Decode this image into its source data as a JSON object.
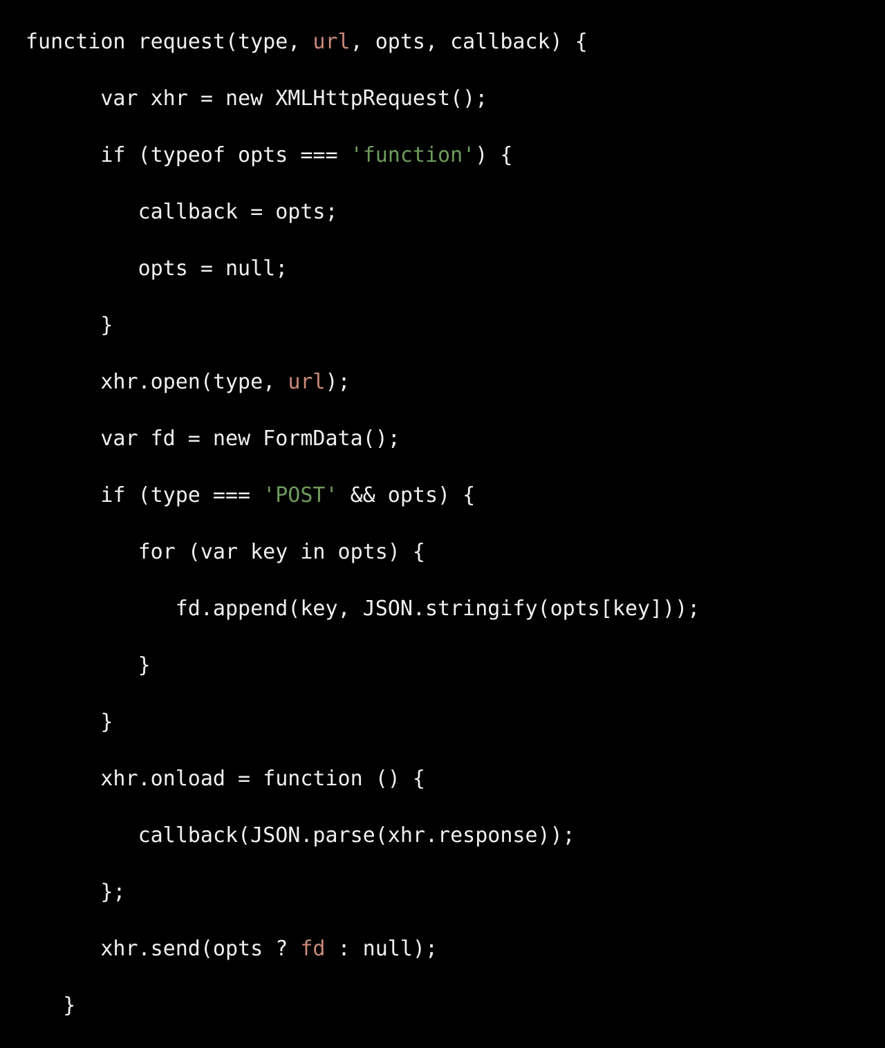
{
  "editor": {
    "background_color": "#000000",
    "default_text_color": "#f2f0ee",
    "variable_token_color": "#c98b7b",
    "string_token_color": "#6f9a5c",
    "language": "javascript"
  },
  "code": {
    "lines": [
      {
        "indent": "",
        "tokens": [
          {
            "t": "function request(type, ",
            "k": "plain"
          },
          {
            "t": "url",
            "k": "var"
          },
          {
            "t": ", opts, callback) {",
            "k": "plain"
          }
        ]
      },
      {
        "indent": "      ",
        "tokens": [
          {
            "t": "var xhr = new XMLHttpRequest();",
            "k": "plain"
          }
        ]
      },
      {
        "indent": "      ",
        "tokens": [
          {
            "t": "if (typeof opts === ",
            "k": "plain"
          },
          {
            "t": "'function'",
            "k": "str"
          },
          {
            "t": ") {",
            "k": "plain"
          }
        ]
      },
      {
        "indent": "         ",
        "tokens": [
          {
            "t": "callback = opts;",
            "k": "plain"
          }
        ]
      },
      {
        "indent": "         ",
        "tokens": [
          {
            "t": "opts = null;",
            "k": "plain"
          }
        ]
      },
      {
        "indent": "      ",
        "tokens": [
          {
            "t": "}",
            "k": "plain"
          }
        ]
      },
      {
        "indent": "      ",
        "tokens": [
          {
            "t": "xhr.open(type, ",
            "k": "plain"
          },
          {
            "t": "url",
            "k": "var"
          },
          {
            "t": ");",
            "k": "plain"
          }
        ]
      },
      {
        "indent": "      ",
        "tokens": [
          {
            "t": "var fd = new FormData();",
            "k": "plain"
          }
        ]
      },
      {
        "indent": "      ",
        "tokens": [
          {
            "t": "if (type === ",
            "k": "plain"
          },
          {
            "t": "'POST'",
            "k": "str"
          },
          {
            "t": " && opts) {",
            "k": "plain"
          }
        ]
      },
      {
        "indent": "         ",
        "tokens": [
          {
            "t": "for (var key in opts) {",
            "k": "plain"
          }
        ]
      },
      {
        "indent": "            ",
        "tokens": [
          {
            "t": "fd.append(key, JSON.stringify(opts[key]));",
            "k": "plain"
          }
        ]
      },
      {
        "indent": "         ",
        "tokens": [
          {
            "t": "}",
            "k": "plain"
          }
        ]
      },
      {
        "indent": "      ",
        "tokens": [
          {
            "t": "}",
            "k": "plain"
          }
        ]
      },
      {
        "indent": "      ",
        "tokens": [
          {
            "t": "xhr.onload = function () {",
            "k": "plain"
          }
        ]
      },
      {
        "indent": "         ",
        "tokens": [
          {
            "t": "callback(JSON.parse(xhr.response));",
            "k": "plain"
          }
        ]
      },
      {
        "indent": "      ",
        "tokens": [
          {
            "t": "};",
            "k": "plain"
          }
        ]
      },
      {
        "indent": "      ",
        "tokens": [
          {
            "t": "xhr.send(opts ? ",
            "k": "plain"
          },
          {
            "t": "fd",
            "k": "var"
          },
          {
            "t": " : null);",
            "k": "plain"
          }
        ]
      },
      {
        "indent": "   ",
        "tokens": [
          {
            "t": "}",
            "k": "plain"
          }
        ]
      }
    ]
  }
}
